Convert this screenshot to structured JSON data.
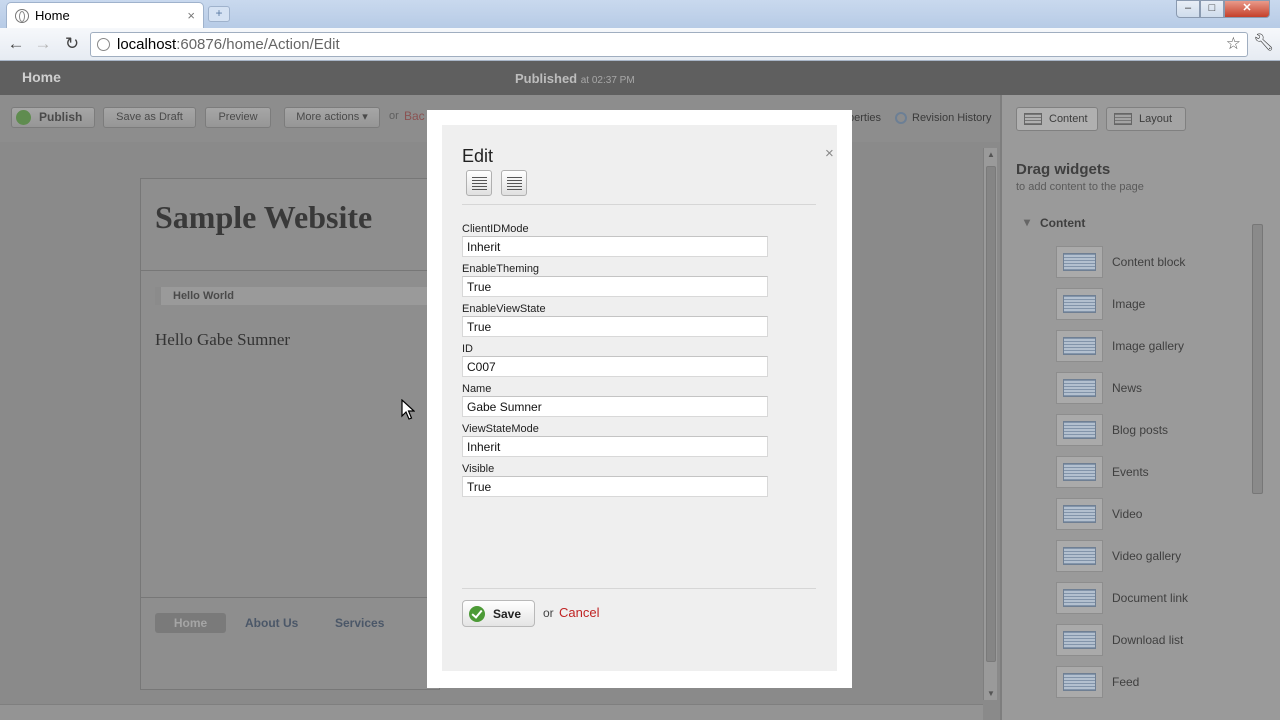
{
  "browser": {
    "tab_title": "Home",
    "tab_close": "×",
    "new_tab": "+",
    "url_host": "localhost",
    "url_rest": ":60876/home/Action/Edit",
    "icons": {
      "back": "back-arrow-icon",
      "forward": "forward-arrow-icon",
      "reload": "reload-icon",
      "star": "bookmark-star-icon",
      "wrench": "wrench-icon"
    }
  },
  "appbar": {
    "home": "Home",
    "status": "Published",
    "status_time": "at 02:37 PM"
  },
  "actions": {
    "publish": "Publish",
    "save_draft": "Save as Draft",
    "preview": "Preview",
    "more_actions": "More actions ▾",
    "or": "or",
    "back": "Bac",
    "properties": "perties",
    "revision_history": "Revision History"
  },
  "page": {
    "site_title": "Sample Website",
    "hello_bar": "Hello World",
    "hello_text": "Hello Gabe Sumner",
    "nav": [
      "Home",
      "About Us",
      "Services"
    ]
  },
  "panel": {
    "tab_content": "Content",
    "tab_layout": "Layout",
    "header": "Drag widgets",
    "subheader": "to add content to the page",
    "group": "Content",
    "widgets": [
      {
        "label": "Content block"
      },
      {
        "label": "Image"
      },
      {
        "label": "Image gallery"
      },
      {
        "label": "News"
      },
      {
        "label": "Blog posts"
      },
      {
        "label": "Events"
      },
      {
        "label": "Video"
      },
      {
        "label": "Video gallery"
      },
      {
        "label": "Document link"
      },
      {
        "label": "Download list"
      },
      {
        "label": "Feed"
      }
    ]
  },
  "modal": {
    "title": "Edit",
    "close": "×",
    "properties": [
      {
        "label": "ClientIDMode",
        "value": "Inherit"
      },
      {
        "label": "EnableTheming",
        "value": "True"
      },
      {
        "label": "EnableViewState",
        "value": "True"
      },
      {
        "label": "ID",
        "value": "C007"
      },
      {
        "label": "Name",
        "value": "Gabe Sumner"
      },
      {
        "label": "ViewStateMode",
        "value": "Inherit"
      },
      {
        "label": "Visible",
        "value": "True"
      }
    ],
    "save": "Save",
    "or": "or",
    "cancel": "Cancel"
  }
}
